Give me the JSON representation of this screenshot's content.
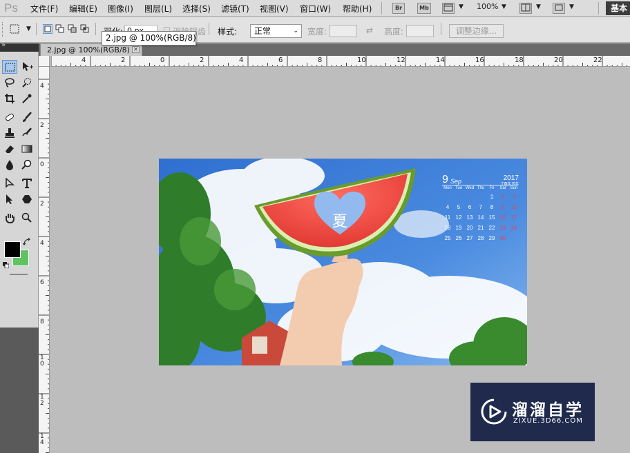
{
  "app": {
    "logo": "Ps"
  },
  "menu": {
    "items": [
      "文件(F)",
      "编辑(E)",
      "图像(I)",
      "图层(L)",
      "选择(S)",
      "滤镜(T)",
      "视图(V)",
      "窗口(W)",
      "帮助(H)"
    ],
    "bridge_label": "Br",
    "minibridge_label": "Mb",
    "zoom": "100%",
    "workspace": "基本"
  },
  "options": {
    "feather_label": "羽化:",
    "feather_value": "0 px",
    "antialias_label": "消除锯齿",
    "style_label": "样式:",
    "style_value": "正常",
    "width_label": "宽度:",
    "height_label": "高度:",
    "refine_edge_label": "调整边缘..."
  },
  "tooltip": "2.jpg @ 100%(RGB/8)",
  "document": {
    "tab_title": "2.jpg @ 100%(RGB/8)",
    "close_glyph": "×"
  },
  "ruler_h": [
    "4",
    "2",
    "0",
    "2",
    "4",
    "6",
    "8",
    "10",
    "12",
    "14",
    "16",
    "18",
    "20",
    "22"
  ],
  "ruler_v": [
    "4",
    "2",
    "0",
    "2",
    "4",
    "6",
    "8",
    "1\n0",
    "1\n2",
    "1\n4"
  ],
  "calendar": {
    "month_number": "9",
    "month_name": "Sep",
    "year": "2017",
    "year_sub": "丁酉年 鸡年",
    "weekdays": [
      "Mon",
      "Tue",
      "Wed",
      "Thu",
      "Fri",
      "Sat",
      "Sun"
    ],
    "rows": [
      [
        "",
        "",
        "",
        "",
        "1",
        "2",
        "3"
      ],
      [
        "4",
        "5",
        "6",
        "7",
        "8",
        "9",
        "10"
      ],
      [
        "11",
        "12",
        "13",
        "14",
        "15",
        "16",
        "17"
      ],
      [
        "18",
        "19",
        "20",
        "21",
        "22",
        "23",
        "24"
      ],
      [
        "25",
        "26",
        "27",
        "28",
        "29",
        "30",
        ""
      ]
    ]
  },
  "watermark": {
    "title": "溜溜自学",
    "url": "ZIXUE.3D66.COM"
  },
  "colors": {
    "foreground": "#000000",
    "background": "#5fc35f",
    "watermark_bg": "#1f2a4d",
    "sky": "#3c7fd8"
  }
}
